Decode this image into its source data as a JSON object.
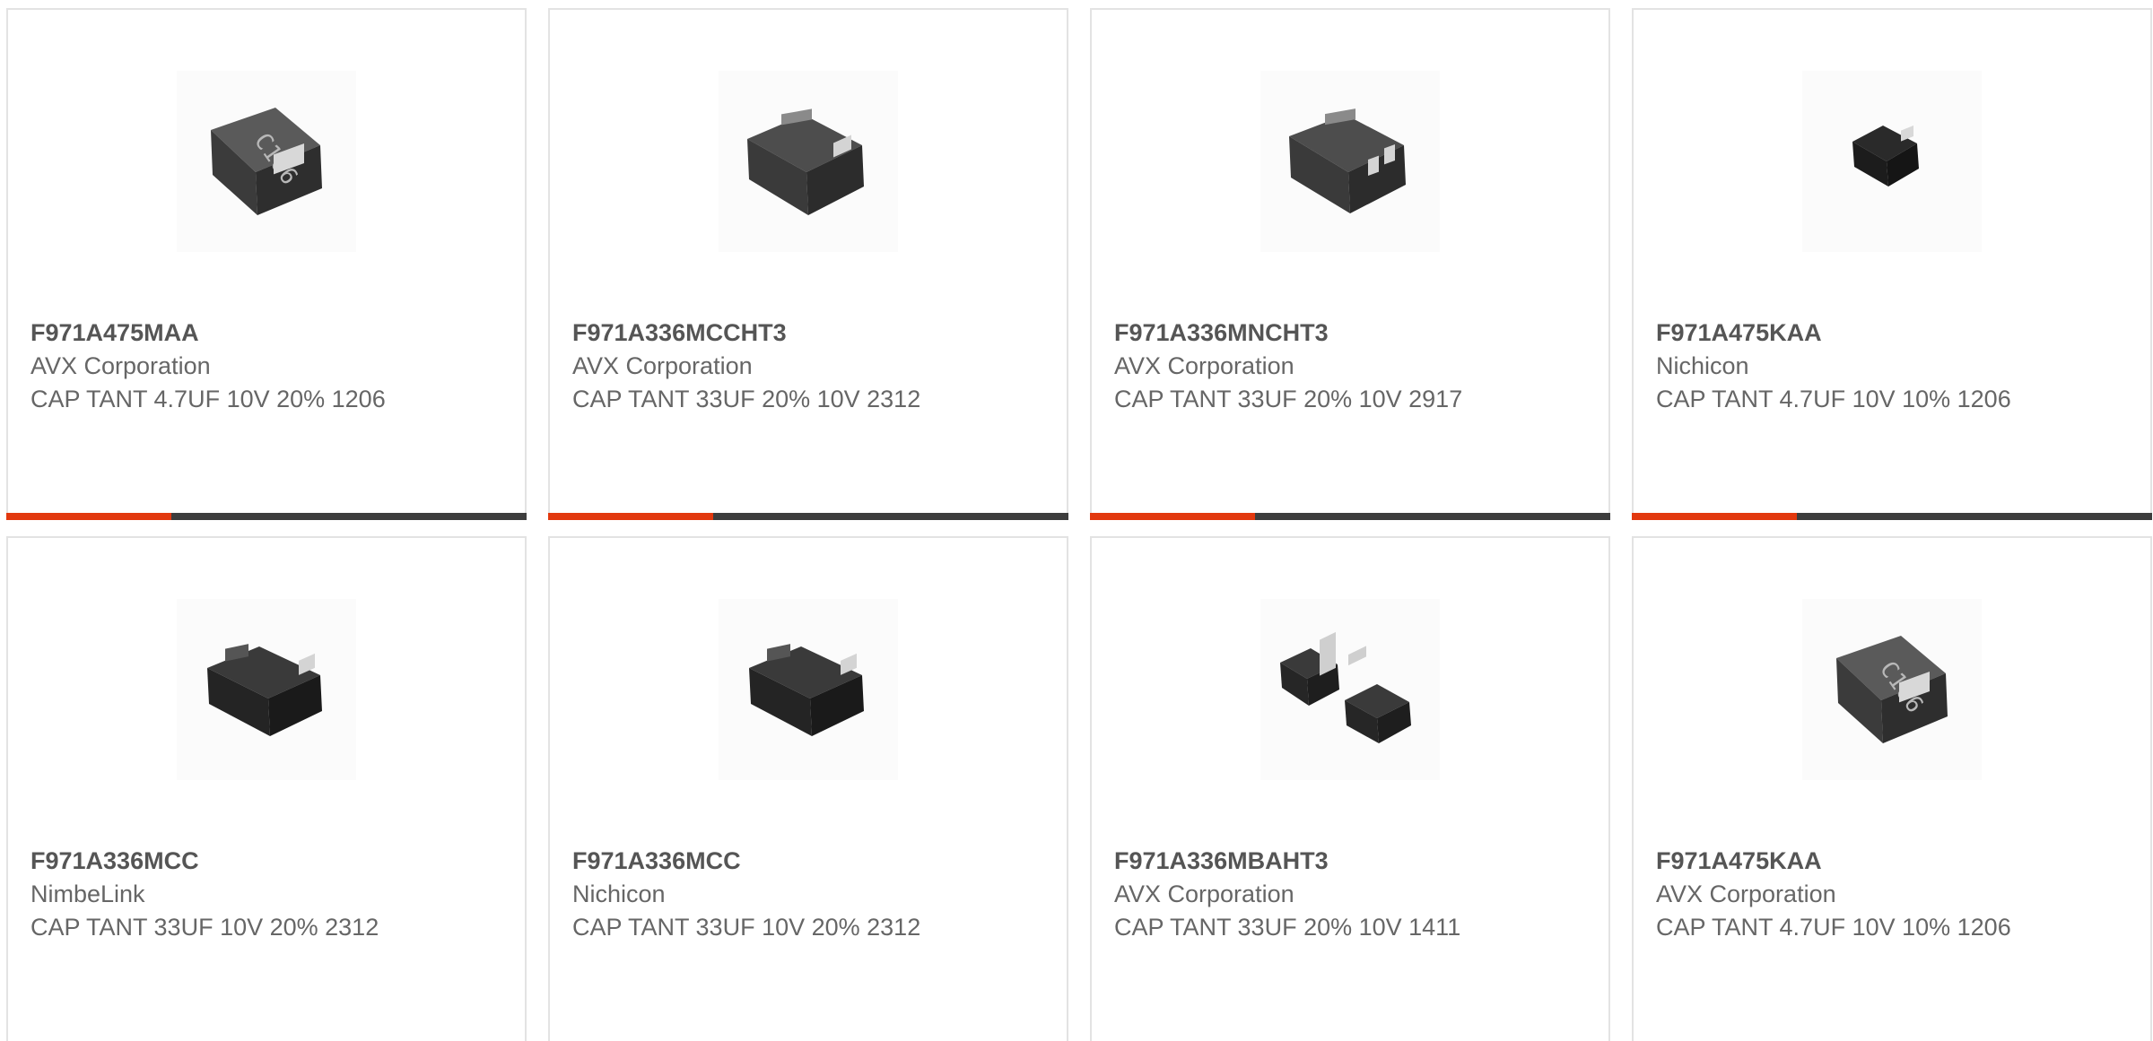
{
  "accent_color": "#e2380e",
  "bar_color": "#3d3d3d",
  "products": [
    {
      "part": "F971A475MAA",
      "manufacturer": "AVX Corporation",
      "description": "CAP TANT 4.7UF 10V 20% 1206",
      "image": "capacitor-marked-icon"
    },
    {
      "part": "F971A336MCCHT3",
      "manufacturer": "AVX Corporation",
      "description": "CAP TANT 33UF 20% 10V 2312",
      "image": "capacitor-icon"
    },
    {
      "part": "F971A336MNCHT3",
      "manufacturer": "AVX Corporation",
      "description": "CAP TANT 33UF 20% 10V 2917",
      "image": "capacitor-icon"
    },
    {
      "part": "F971A475KAA",
      "manufacturer": "Nichicon",
      "description": "CAP TANT 4.7UF 10V 10% 1206",
      "image": "capacitor-small-icon"
    },
    {
      "part": "F971A336MCC",
      "manufacturer": "NimbeLink",
      "description": "CAP TANT 33UF 10V 20% 2312",
      "image": "capacitor-icon"
    },
    {
      "part": "F971A336MCC",
      "manufacturer": "Nichicon",
      "description": "CAP TANT 33UF 10V 20% 2312",
      "image": "capacitor-icon"
    },
    {
      "part": "F971A336MBAHT3",
      "manufacturer": "AVX Corporation",
      "description": "CAP TANT 33UF 20% 10V 1411",
      "image": "capacitor-pair-icon"
    },
    {
      "part": "F971A475KAA",
      "manufacturer": "AVX Corporation",
      "description": "CAP TANT 4.7UF 10V 10% 1206",
      "image": "capacitor-marked-icon"
    }
  ]
}
